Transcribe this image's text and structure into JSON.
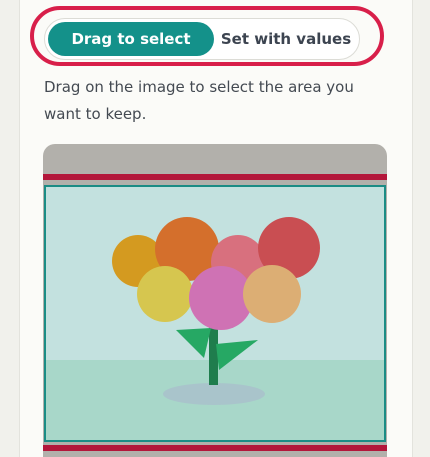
{
  "mode_toggle": {
    "options": [
      {
        "label": "Drag to select",
        "selected": true
      },
      {
        "label": "Set with values",
        "selected": false
      }
    ]
  },
  "instructions": "Drag on the image to select the area you want to keep.",
  "colors": {
    "accent": "#14918a",
    "highlight": "#d81f4a",
    "selection_border": "#1b8c85",
    "crop_band": "#b3163a"
  },
  "image": {
    "subject": "flower-illustration",
    "petal_colors": [
      "#d49a20",
      "#d46f2c",
      "#d8707e",
      "#c94e52",
      "#d6c64f",
      "#cf72b4",
      "#dcae74"
    ]
  }
}
